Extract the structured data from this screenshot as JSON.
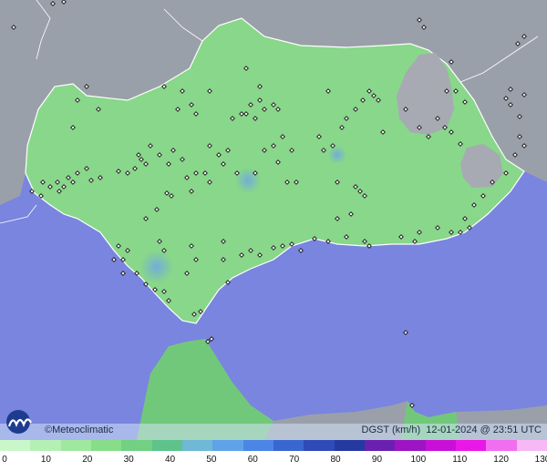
{
  "brand": {
    "name": "Meteoclimatic",
    "copyright_symbol": "©",
    "logo_icon": "meteoclimatic-logo-icon"
  },
  "info": {
    "variable": "DGST (km/h)",
    "datetime": "12-01-2024 @ 23:51 UTC"
  },
  "legend": {
    "labels": [
      "0",
      "10",
      "20",
      "30",
      "40",
      "50",
      "60",
      "70",
      "80",
      "90",
      "100",
      "110",
      "120",
      "130"
    ],
    "colors": [
      "#c9f7c9",
      "#b4f0b4",
      "#9fe89f",
      "#88dd88",
      "#72d083",
      "#5dc38b",
      "#6fb8d6",
      "#5ea3e8",
      "#4b86e6",
      "#3a66cf",
      "#2f4bb8",
      "#243aa0",
      "#6a20b0",
      "#9d14c4",
      "#c810d8",
      "#ea18e6",
      "#f26ef0",
      "#f7b8f6"
    ]
  },
  "colors": {
    "sea": "#7985de",
    "land_outside": "#9aa0aa",
    "region": "#88d78a",
    "border": "#ffffff"
  },
  "stations_note": "",
  "map_marker_icon": "station-diamond-icon"
}
